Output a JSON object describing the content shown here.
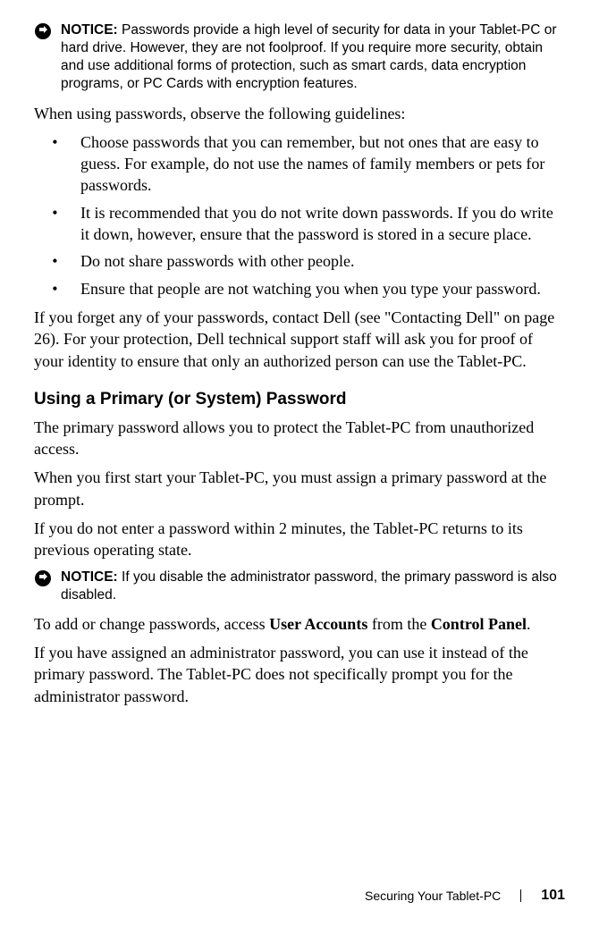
{
  "notice1": {
    "label": "NOTICE:",
    "text": "Passwords provide a high level of security for data in your Tablet-PC or hard drive. However, they are not foolproof. If you require more security, obtain and use additional forms of protection, such as smart cards, data encryption programs, or PC Cards with encryption features."
  },
  "para1": "When using passwords, observe the following guidelines:",
  "bullets": [
    "Choose passwords that you can remember, but not ones that are easy to guess. For example, do not use the names of family members or pets for passwords.",
    "It is recommended that you do not write down passwords. If you do write it down, however, ensure that the password is stored in a secure place.",
    "Do not share passwords with other people.",
    "Ensure that people are not watching you when you type your password."
  ],
  "para2": "If you forget any of your passwords, contact Dell (see \"Contacting Dell\" on page 26). For your protection, Dell technical support staff will ask you for proof of your identity to ensure that only an authorized person can use the Tablet-PC.",
  "heading1": "Using a Primary (or System) Password",
  "para3": "The primary password allows you to protect the Tablet-PC from unauthorized access.",
  "para4": "When you first start your Tablet-PC, you must assign a primary password at the prompt.",
  "para5": "If you do not enter a password within 2 minutes, the Tablet-PC returns to its previous operating state.",
  "notice2": {
    "label": "NOTICE:",
    "text": "If you disable the administrator password, the primary password is also disabled."
  },
  "para6_pre": "To add or change passwords, access ",
  "para6_bold1": "User Accounts",
  "para6_mid": " from the ",
  "para6_bold2": "Control Panel",
  "para6_post": ".",
  "para7": "If you have assigned an administrator password, you can use it instead of the primary password. The Tablet-PC does not specifically prompt you for the administrator password.",
  "footer": {
    "section": "Securing Your Tablet-PC",
    "page": "101"
  }
}
